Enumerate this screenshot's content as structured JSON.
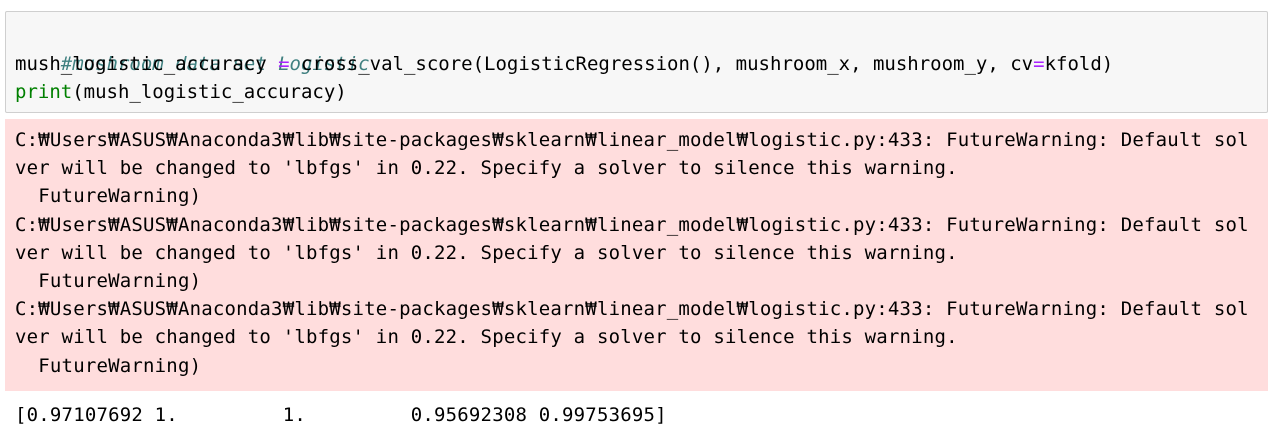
{
  "code": {
    "comment": "#mushroom data set Logistic",
    "line2_a": "mush_logistic_accuracy ",
    "line2_eq1": "=",
    "line2_b": " cross_val_score(LogisticRegression(), mushroom_x, mushroom_y, cv",
    "line2_eq2": "=",
    "line2_c": "kfold)",
    "line3_print": "print",
    "line3_args": "(mush_logistic_accuracy)"
  },
  "stderr": {
    "lines": [
      "C:₩Users₩ASUS₩Anaconda3₩lib₩site-packages₩sklearn₩linear_model₩logistic.py:433: FutureWarning: Default sol",
      "ver will be changed to 'lbfgs' in 0.22. Specify a solver to silence this warning.",
      "  FutureWarning)",
      "C:₩Users₩ASUS₩Anaconda3₩lib₩site-packages₩sklearn₩linear_model₩logistic.py:433: FutureWarning: Default sol",
      "ver will be changed to 'lbfgs' in 0.22. Specify a solver to silence this warning.",
      "  FutureWarning)",
      "C:₩Users₩ASUS₩Anaconda3₩lib₩site-packages₩sklearn₩linear_model₩logistic.py:433: FutureWarning: Default sol",
      "ver will be changed to 'lbfgs' in 0.22. Specify a solver to silence this warning.",
      "  FutureWarning)"
    ]
  },
  "stdout": {
    "result": "[0.97107692 1.         1.         0.95692308 0.99753695]"
  },
  "colors": {
    "code_background": "#f7f7f7",
    "code_border": "#cfcfcf",
    "comment": "#408080",
    "operator": "#aa22ff",
    "builtin": "#008000",
    "stderr_background": "#ffdddd"
  }
}
